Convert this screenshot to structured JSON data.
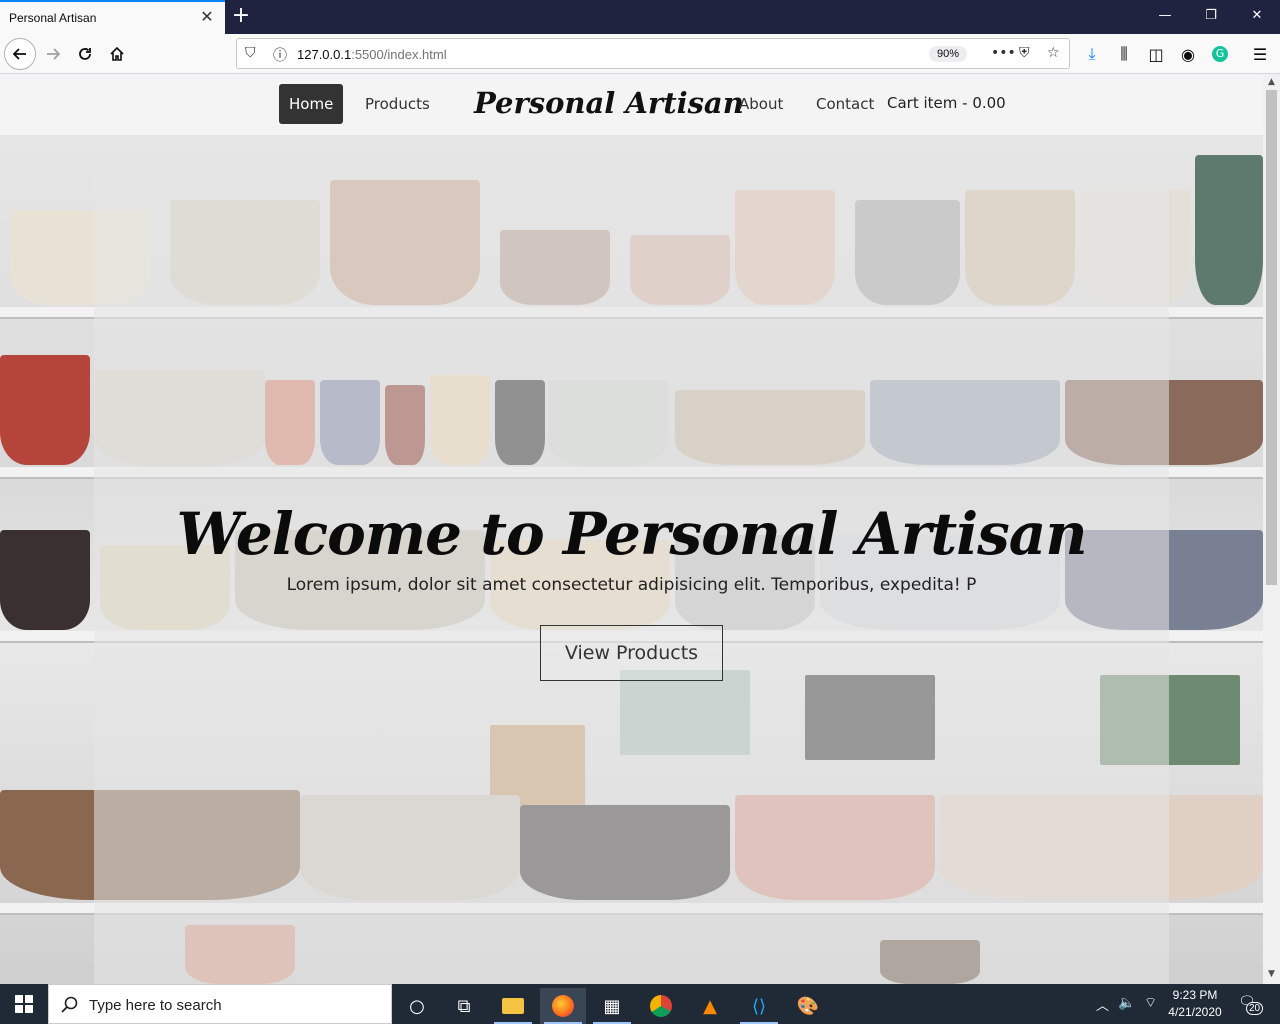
{
  "browser": {
    "tab_title": "Personal Artisan",
    "tab_close": "✕",
    "new_tab": "+",
    "url_host": "127.0.0.1",
    "url_rest": ":5500/index.html",
    "zoom": "90%",
    "window_controls": [
      "—",
      "❐",
      "✕"
    ]
  },
  "site": {
    "nav": {
      "home": "Home",
      "products": "Products",
      "brand": "Personal Artisan",
      "about": "About",
      "contact": "Contact",
      "cart": "Cart item - 0.00"
    },
    "hero": {
      "title": "Welcome to Personal Artisan",
      "subtitle": "Lorem ipsum, dolor sit amet consectetur adipisicing elit. Temporibus, expedita! P",
      "button": "View Products"
    }
  },
  "taskbar": {
    "search_placeholder": "Type here to search",
    "time": "9:23 PM",
    "date": "4/21/2020",
    "notification_count": "20"
  }
}
